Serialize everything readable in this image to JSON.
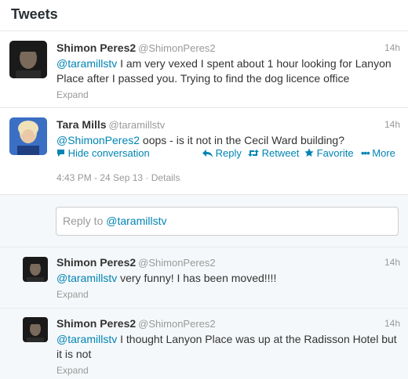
{
  "header": {
    "title": "Tweets"
  },
  "tweets": [
    {
      "fullname": "Shimon Peres2",
      "screen_name": "@ShimonPeres2",
      "time": "14h",
      "mention": "@taramillstv",
      "text": " I am very vexed I spent about 1 hour looking for Lanyon Place after I passed you. Trying to find the dog licence office",
      "expand": "Expand"
    },
    {
      "fullname": "Tara Mills",
      "screen_name": "@taramillstv",
      "time": "14h",
      "mention": "@ShimonPeres2",
      "text": " oops - is it not in the Cecil Ward building?",
      "hide_conversation": "Hide conversation",
      "reply": "Reply",
      "retweet": "Retweet",
      "favorite": "Favorite",
      "more": "More",
      "timestamp": "4:43 PM - 24 Sep 13",
      "details": "Details"
    }
  ],
  "reply_box": {
    "prefix": "Reply to ",
    "handle": "@taramillstv"
  },
  "replies": [
    {
      "fullname": "Shimon Peres2",
      "screen_name": "@ShimonPeres2",
      "time": "14h",
      "mention": "@taramillstv",
      "text": " very funny! I has been moved!!!!",
      "expand": "Expand"
    },
    {
      "fullname": "Shimon Peres2",
      "screen_name": "@ShimonPeres2",
      "time": "14h",
      "mention": "@taramillstv",
      "text": " I thought Lanyon Place was up at the Radisson Hotel but it is not",
      "expand": "Expand"
    }
  ],
  "colors": {
    "link": "#0084b4",
    "muted": "#999999",
    "border": "#e8e8e8"
  },
  "icons": [
    "speech-bubble-icon",
    "reply-arrow-icon",
    "retweet-icon",
    "star-icon",
    "more-dots-icon"
  ]
}
